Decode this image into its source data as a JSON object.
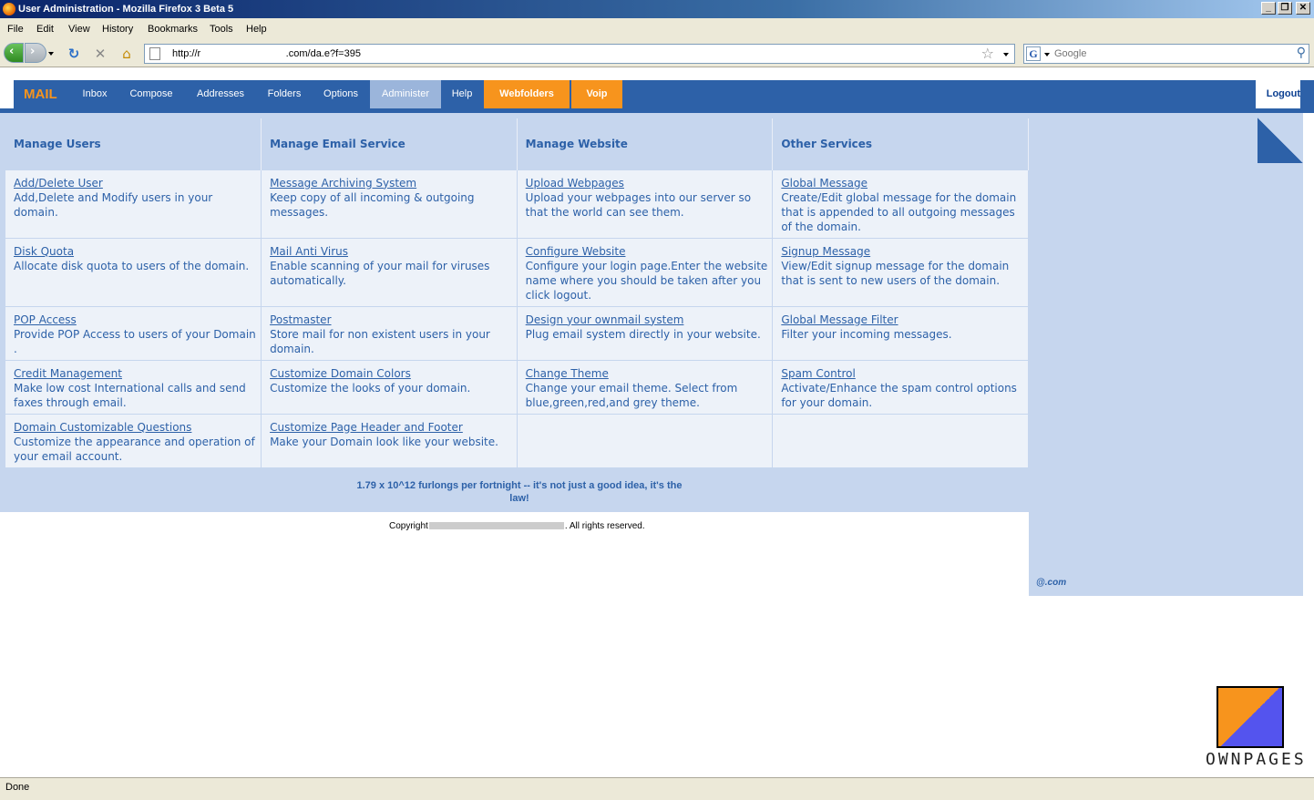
{
  "window": {
    "title": "User Administration - Mozilla Firefox 3 Beta 5",
    "buttons": [
      "_",
      "❐",
      "✕"
    ]
  },
  "menu": [
    "File",
    "Edit",
    "View",
    "History",
    "Bookmarks",
    "Tools",
    "Help"
  ],
  "toolbar": {
    "url": "http://r                 .com/da.e?f=395",
    "search_placeholder": "Google"
  },
  "app": {
    "brand": "MAIL",
    "tabs": [
      {
        "label": "Inbox"
      },
      {
        "label": "Compose"
      },
      {
        "label": "Addresses"
      },
      {
        "label": "Folders"
      },
      {
        "label": "Options"
      },
      {
        "label": "Administer"
      },
      {
        "label": "Help"
      },
      {
        "label": "Webfolders"
      },
      {
        "label": "Voip"
      }
    ],
    "logout": "Logout"
  },
  "admin": {
    "headers": [
      "Manage Users",
      "Manage Email Service",
      "Manage Website",
      "Other Services"
    ],
    "rows": [
      [
        {
          "title": "Add/Delete User",
          "desc": "Add,Delete and Modify users in your domain."
        },
        {
          "title": "Message Archiving System",
          "desc": "Keep copy of all incoming & outgoing messages."
        },
        {
          "title": "Upload Webpages",
          "desc": "Upload your webpages into our server so that the world can see them."
        },
        {
          "title": "Global Message",
          "desc": "Create/Edit global message for the domain that is appended to all outgoing messages of the domain."
        }
      ],
      [
        {
          "title": "Disk Quota",
          "desc": "Allocate disk quota to users of the domain."
        },
        {
          "title": "Mail Anti Virus",
          "desc": "Enable scanning of your mail for viruses automatically."
        },
        {
          "title": "Configure Website",
          "desc": "Configure your login page.Enter the website name where you should be taken after you click logout."
        },
        {
          "title": "Signup Message",
          "desc": "View/Edit signup message for the domain that is sent to new users of the domain."
        }
      ],
      [
        {
          "title": "POP Access",
          "desc": "Provide POP Access to users of your Domain ."
        },
        {
          "title": "Postmaster",
          "desc": "Store mail for non existent users in your domain."
        },
        {
          "title": "Design your ownmail system",
          "desc": "Plug email system directly in your website."
        },
        {
          "title": "Global Message Filter",
          "desc": "Filter your incoming messages."
        }
      ],
      [
        {
          "title": "Credit Management",
          "desc": "Make low cost International calls and send faxes through email."
        },
        {
          "title": "Customize Domain Colors",
          "desc": "Customize the looks of your domain."
        },
        {
          "title": "Change Theme",
          "desc": "Change your email theme. Select from blue,green,red,and grey theme."
        },
        {
          "title": "Spam Control",
          "desc": "Activate/Enhance the spam control options for your domain."
        }
      ],
      [
        {
          "title": "Domain Customizable Questions",
          "desc": "Customize the appearance and operation of your email account."
        },
        {
          "title": "Customize Page Header and Footer",
          "desc": "Make your Domain look like your website."
        },
        {
          "title": "",
          "desc": ""
        },
        {
          "title": "",
          "desc": ""
        }
      ]
    ]
  },
  "footer": {
    "tagline": "1.79 x 10^12 furlongs per fortnight -- it's not just a good idea, it's the law!",
    "copyright_prefix": "Copyright",
    "copyright_suffix": ". All rights reserved."
  },
  "sidebar": {
    "email": "@.com"
  },
  "logo": {
    "label": "OWNPAGES"
  },
  "status": "Done",
  "colors": {
    "nav_blue": "#2d61a8",
    "accent_orange": "#f7941d",
    "panel_blue": "#c6d6ee",
    "cell_bg": "#edf2f9"
  }
}
